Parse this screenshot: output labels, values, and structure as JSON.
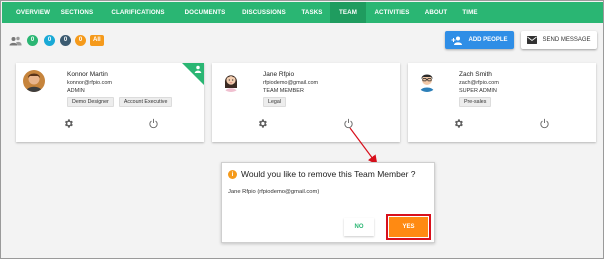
{
  "nav": {
    "tabs": [
      "OVERVIEW",
      "SECTIONS",
      "CLARIFICATIONS",
      "DOCUMENTS",
      "DISCUSSIONS",
      "TASKS",
      "TEAM",
      "ACTIVITIES",
      "ABOUT",
      "TIME"
    ],
    "active": "TEAM"
  },
  "toolbar": {
    "badges": [
      {
        "label": "0",
        "color": "#2ab673"
      },
      {
        "label": "0",
        "color": "#19a9d6"
      },
      {
        "label": "0",
        "color": "#3b5a70"
      },
      {
        "label": "0",
        "color": "#f59a1b"
      },
      {
        "label": "All",
        "color": "#f59a1b"
      }
    ],
    "add_people_label": "ADD PEOPLE",
    "send_message_label": "SEND MESSAGE"
  },
  "cards": [
    {
      "name": "Konnor Martin",
      "email": "konnor@rfpio.com",
      "role": "ADMIN",
      "tags": [
        "Demo Designer",
        "Account Executive"
      ],
      "owner": true
    },
    {
      "name": "Jane Rfpio",
      "email": "rfpiodemo@gmail.com",
      "role": "TEAM MEMBER",
      "tags": [
        "Legal"
      ],
      "owner": false
    },
    {
      "name": "Zach Smith",
      "email": "zach@rfpio.com",
      "role": "SUPER ADMIN",
      "tags": [
        "Pre-sales"
      ],
      "owner": false
    }
  ],
  "dialog": {
    "icon": "i",
    "title": "Would you like to remove this Team Member ?",
    "body": "Jane Rfpio (rfpiodemo@gmail.com)",
    "no_label": "NO",
    "yes_label": "YES"
  },
  "colors": {
    "nav_green": "#2ab673",
    "add_blue": "#2f8ee6",
    "yes_orange": "#ff8a12",
    "highlight_red": "#d8101c"
  }
}
